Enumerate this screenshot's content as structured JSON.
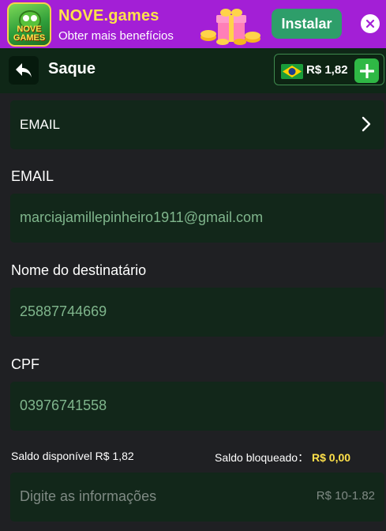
{
  "banner": {
    "app_name": "NOVE.games",
    "subtitle": "Obter mais benefícios",
    "logo_text": "NOVE GAMES",
    "install_label": "Instalar"
  },
  "header": {
    "title": "Saque",
    "balance": "R$ 1,82"
  },
  "form": {
    "method_select": "EMAIL",
    "email_label": "EMAIL",
    "email_value": "marciajamillepinheiro1911@gmail.com",
    "recipient_label": "Nome do destinatário",
    "recipient_value": "25887744669",
    "cpf_label": "CPF",
    "cpf_value": "03976741558",
    "available_label": "Saldo disponível R$ 1,82",
    "blocked_label": "Saldo bloqueado：",
    "blocked_value": "R$ 0,00",
    "amount_placeholder": "Digite as informações",
    "amount_range": "R$ 10-1.82"
  },
  "colors": {
    "banner_bg": "#a31fd6",
    "banner_title": "#ffe24a",
    "install_button": "#2e9e6a",
    "header_bg": "#0f2717",
    "field_bg": "#12271a",
    "field_value": "#7fb58c",
    "add_button": "#2fb845",
    "highlight": "#ffe14a"
  },
  "icons": [
    "frog-logo-icon",
    "gift-coins-icon",
    "close-icon",
    "back-arrow-icon",
    "brazil-flag-icon",
    "plus-icon",
    "chevron-right-icon"
  ]
}
